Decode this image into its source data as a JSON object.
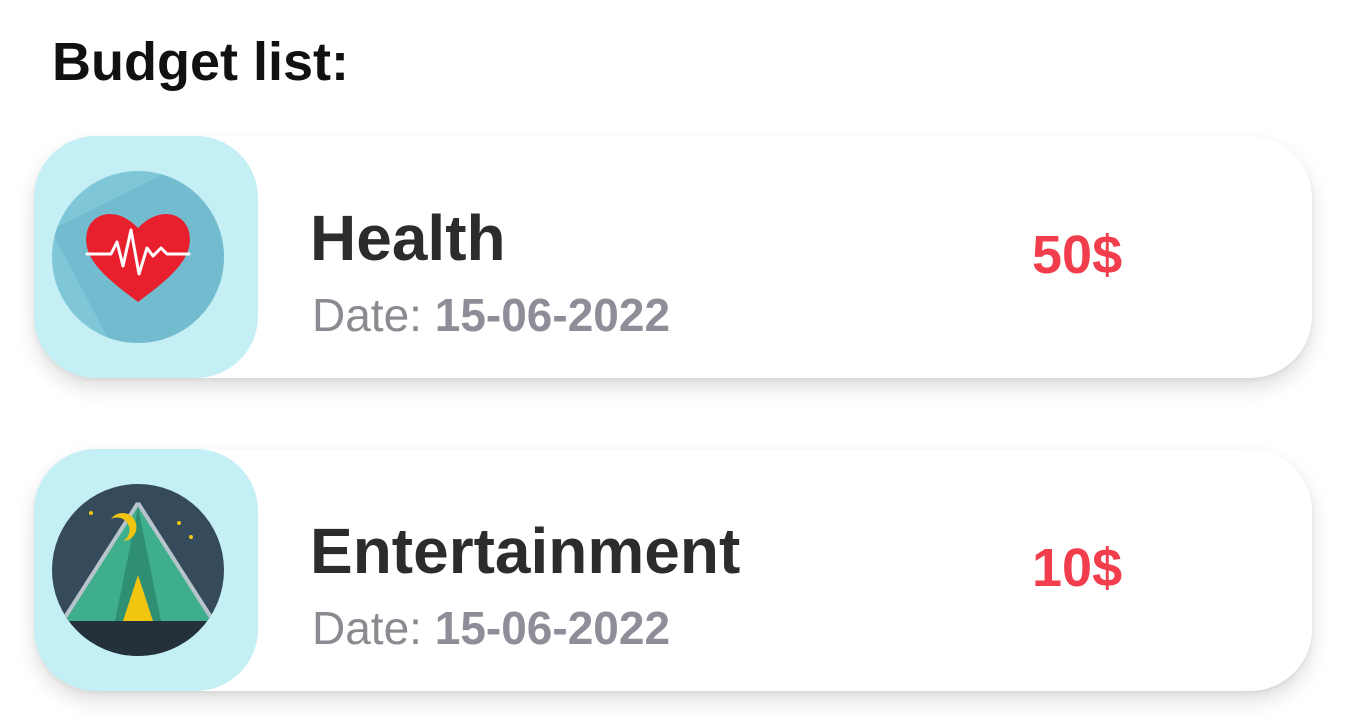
{
  "header": {
    "title": "Budget list:"
  },
  "items": [
    {
      "title": "Health",
      "date_label": "Date: ",
      "date": "15-06-2022",
      "amount": "50$",
      "icon": "heart-pulse-icon"
    },
    {
      "title": "Entertainment",
      "date_label": "Date: ",
      "date": "15-06-2022",
      "amount": "10$",
      "icon": "camping-tent-icon"
    }
  ],
  "colors": {
    "icon_background": "#c3eff5",
    "amount": "#f13d4c",
    "title": "#2c2c2e",
    "date": "#8e8e99"
  }
}
